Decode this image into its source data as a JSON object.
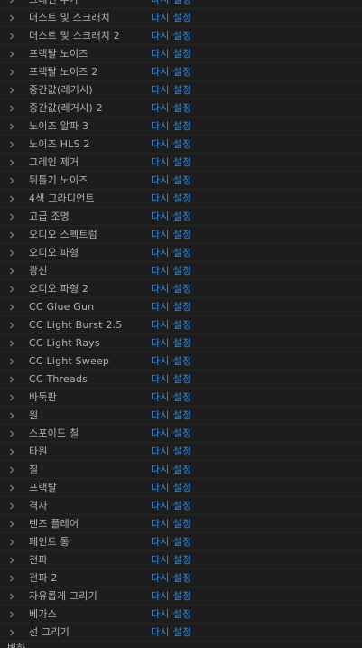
{
  "effects": [
    {
      "name": "그레인 추가"
    },
    {
      "name": "더스트 및 스크래치"
    },
    {
      "name": "더스트 및 스크래치 2"
    },
    {
      "name": "프랙탈 노이즈"
    },
    {
      "name": "프랙탈 노이즈 2"
    },
    {
      "name": "중간값(레거시)"
    },
    {
      "name": "중간값(레거시) 2"
    },
    {
      "name": "노이즈 알파 3"
    },
    {
      "name": "노이즈 HLS 2"
    },
    {
      "name": "그레인 제거"
    },
    {
      "name": "뒤틀기 노이즈"
    },
    {
      "name": "4색 그라디언트"
    },
    {
      "name": "고급 조명"
    },
    {
      "name": "오디오 스펙트럼"
    },
    {
      "name": "오디오 파형"
    },
    {
      "name": "광선"
    },
    {
      "name": "오디오 파형 2"
    },
    {
      "name": "CC Glue Gun"
    },
    {
      "name": "CC Light Burst 2.5"
    },
    {
      "name": "CC Light Rays"
    },
    {
      "name": "CC Light Sweep"
    },
    {
      "name": "CC Threads"
    },
    {
      "name": "바둑판"
    },
    {
      "name": "원"
    },
    {
      "name": "스포이드 칠"
    },
    {
      "name": "타원"
    },
    {
      "name": "칠"
    },
    {
      "name": "프랙탈"
    },
    {
      "name": "격자"
    },
    {
      "name": "렌즈 플레어"
    },
    {
      "name": "페인트 통"
    },
    {
      "name": "전파"
    },
    {
      "name": "전파 2"
    },
    {
      "name": "자유롭게 그리기"
    },
    {
      "name": "베가스"
    },
    {
      "name": "선 그리기"
    }
  ],
  "reset_label": "다시 설정",
  "bottom_partial_label": "변하",
  "icons": {
    "expand": "chevron-right-icon"
  },
  "colors": {
    "background": "#1d1d1d",
    "label": "#b4b4b4",
    "link": "#2d8ceb"
  }
}
